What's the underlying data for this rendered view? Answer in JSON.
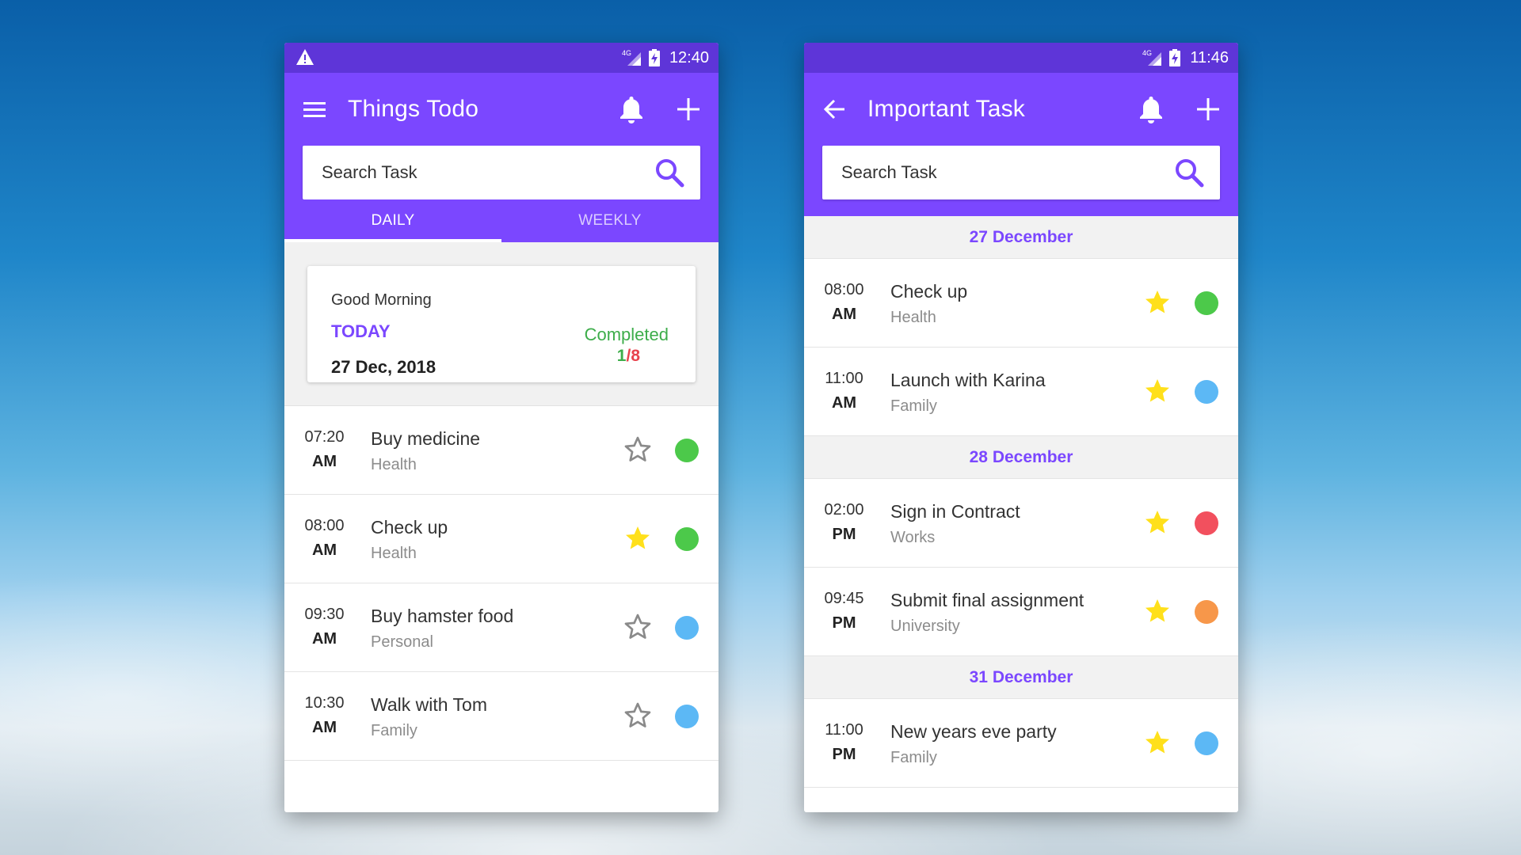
{
  "left_phone": {
    "status": {
      "time": "12:40",
      "network": "4G"
    },
    "app_bar": {
      "title": "Things Todo"
    },
    "search": {
      "placeholder": "Search Task"
    },
    "tabs": [
      {
        "label": "DAILY",
        "active": true
      },
      {
        "label": "WEEKLY",
        "active": false
      }
    ],
    "summary": {
      "greeting": "Good Morning",
      "today_label": "TODAY",
      "date": "27 Dec, 2018",
      "completed_label": "Completed",
      "completed_done": "1",
      "completed_sep": "/",
      "completed_total": "8"
    },
    "tasks": [
      {
        "hm": "07:20",
        "ampm": "AM",
        "title": "Buy medicine",
        "category": "Health",
        "starred": false,
        "dot_color": "#4cc94a"
      },
      {
        "hm": "08:00",
        "ampm": "AM",
        "title": "Check up",
        "category": "Health",
        "starred": true,
        "dot_color": "#4cc94a"
      },
      {
        "hm": "09:30",
        "ampm": "AM",
        "title": "Buy hamster food",
        "category": "Personal",
        "starred": false,
        "dot_color": "#5cb8f5"
      },
      {
        "hm": "10:30",
        "ampm": "AM",
        "title": "Walk with Tom",
        "category": "Family",
        "starred": false,
        "dot_color": "#5cb8f5"
      }
    ]
  },
  "right_phone": {
    "status": {
      "time": "11:46",
      "network": "4G"
    },
    "app_bar": {
      "title": "Important Task"
    },
    "search": {
      "placeholder": "Search Task"
    },
    "groups": [
      {
        "date": "27 December",
        "tasks": [
          {
            "hm": "08:00",
            "ampm": "AM",
            "title": "Check up",
            "category": "Health",
            "starred": true,
            "dot_color": "#4cc94a"
          },
          {
            "hm": "11:00",
            "ampm": "AM",
            "title": "Launch with Karina",
            "category": "Family",
            "starred": true,
            "dot_color": "#5cb8f5"
          }
        ]
      },
      {
        "date": "28 December",
        "tasks": [
          {
            "hm": "02:00",
            "ampm": "PM",
            "title": "Sign in Contract",
            "category": "Works",
            "starred": true,
            "dot_color": "#f2505e"
          },
          {
            "hm": "09:45",
            "ampm": "PM",
            "title": "Submit final assignment",
            "category": "University",
            "starred": true,
            "dot_color": "#f7974a"
          }
        ]
      },
      {
        "date": "31 December",
        "tasks": [
          {
            "hm": "11:00",
            "ampm": "PM",
            "title": "New years eve party",
            "category": "Family",
            "starred": true,
            "dot_color": "#5cb8f5"
          }
        ]
      }
    ]
  },
  "colors": {
    "primary": "#7b47ff",
    "status_bar": "#5e35d8",
    "star_filled": "#ffe01b",
    "star_outline": "#8a8a8a",
    "completed_green": "#3dad4a",
    "total_red": "#e8434d"
  },
  "icons": {
    "menu": "menu-icon",
    "back": "back-arrow-icon",
    "bell": "bell-icon",
    "add": "plus-icon",
    "search": "search-icon",
    "star": "star-icon",
    "warning": "warning-icon"
  }
}
